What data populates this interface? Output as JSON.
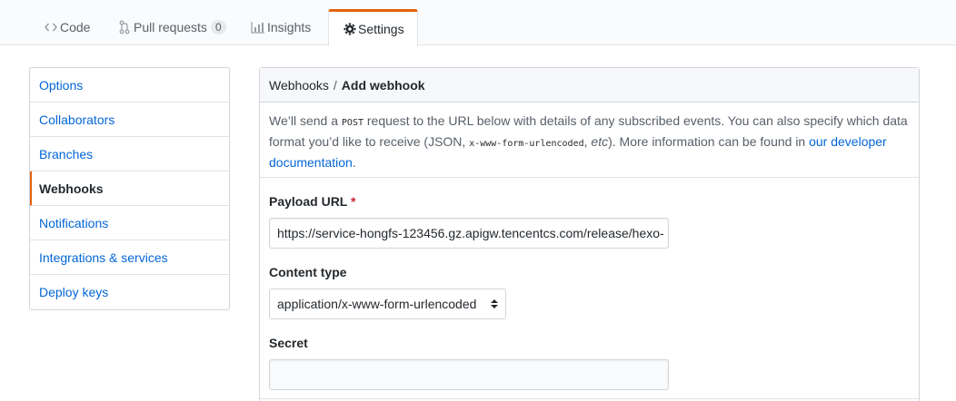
{
  "tabs": {
    "code": {
      "label": "Code",
      "icon": "code-icon"
    },
    "pull_requests": {
      "label": "Pull requests",
      "count": "0",
      "icon": "git-pull-request-icon"
    },
    "insights": {
      "label": "Insights",
      "icon": "graph-icon"
    },
    "settings": {
      "label": "Settings",
      "icon": "gear-icon",
      "selected": true
    }
  },
  "sidebar": {
    "items": [
      {
        "label": "Options"
      },
      {
        "label": "Collaborators"
      },
      {
        "label": "Branches"
      },
      {
        "label": "Webhooks",
        "selected": true
      },
      {
        "label": "Notifications"
      },
      {
        "label": "Integrations & services"
      },
      {
        "label": "Deploy keys"
      }
    ]
  },
  "header": {
    "parent": "Webhooks",
    "separator": "/",
    "current": "Add webhook"
  },
  "description": {
    "part1": "We’ll send a ",
    "post": "POST",
    "part2": " request to the URL below with details of any subscribed events. You can also specify which data format you’d like to receive (JSON, ",
    "form_type": "x-www-form-urlencoded",
    "part3": ", ",
    "etc": "etc",
    "part4": "). More information can be found in ",
    "link": "our developer documentation",
    "part5": "."
  },
  "form": {
    "payload_url": {
      "label": "Payload URL",
      "required_mark": "*",
      "value": "https://service-hongfs-123456.gz.apigw.tencentcs.com/release/hexo-"
    },
    "content_type": {
      "label": "Content type",
      "value": "application/x-www-form-urlencoded"
    },
    "secret": {
      "label": "Secret",
      "value": ""
    }
  },
  "colors": {
    "accent": "#e36209",
    "link": "#0366d6",
    "required": "#cb2431"
  }
}
